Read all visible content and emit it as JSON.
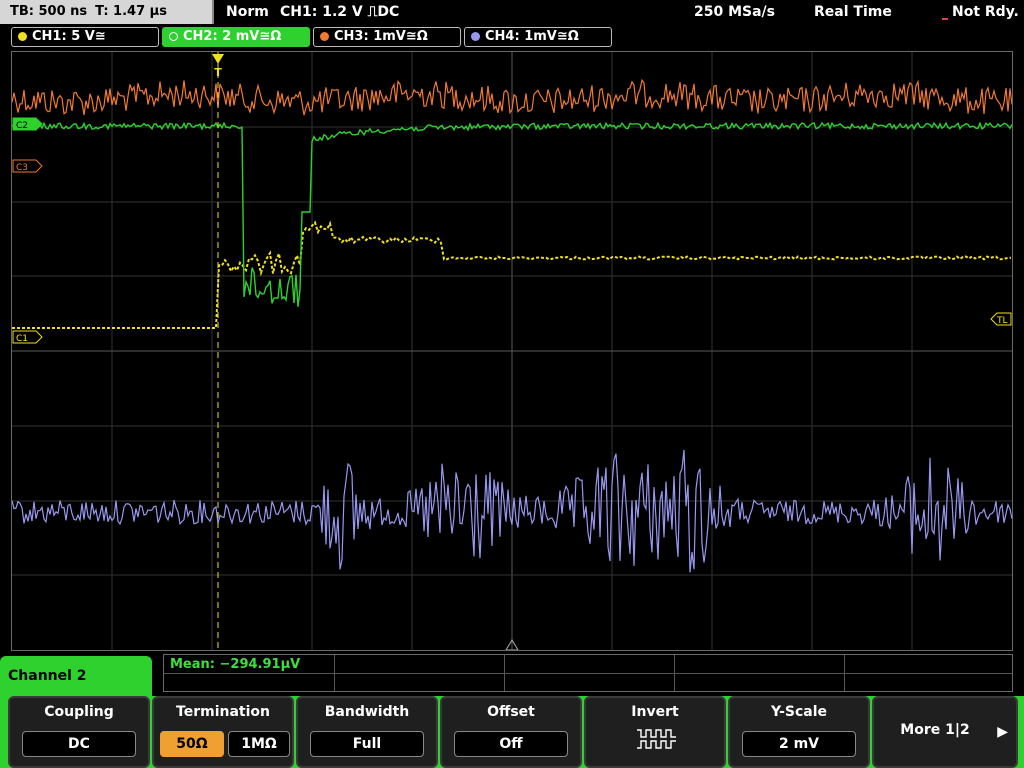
{
  "status": {
    "timebase": "TB: 500 ns",
    "trigger_time": "T: 1.47 µs",
    "mode": "Norm",
    "trigger_info": "CH1: 1.2 V ⎍DC",
    "sample_rate": "250 MSa/s",
    "acquire_mode": "Real Time",
    "ready_state": "Not Rdy."
  },
  "channels": [
    {
      "label": "CH1: 5 V≅",
      "color": "#f0e020"
    },
    {
      "label": "CH2: 2 mV≅Ω",
      "color": "#2ed12e"
    },
    {
      "label": "CH3: 1mV≅Ω",
      "color": "#f07a30"
    },
    {
      "label": "CH4: 1mV≅Ω",
      "color": "#9898f0"
    }
  ],
  "markers": {
    "c3": "C3",
    "c2": "C2",
    "c1": "C1",
    "tl": "TL",
    "trigger": "T"
  },
  "measurement": {
    "mean": "Mean: −294.91µV"
  },
  "panel_title": "Channel 2",
  "softkeys": {
    "coupling": {
      "title": "Coupling",
      "value": "DC"
    },
    "termination": {
      "title": "Termination",
      "opt1": "50Ω",
      "opt2": "1MΩ"
    },
    "bandwidth": {
      "title": "Bandwidth",
      "value": "Full"
    },
    "offset": {
      "title": "Offset",
      "value": "Off"
    },
    "invert": {
      "title": "Invert"
    },
    "yscale": {
      "title": "Y-Scale",
      "value": "2 mV"
    },
    "more": {
      "label": "More 1|2"
    }
  },
  "colors": {
    "grid": "#404040",
    "accent": "#2ed12e",
    "termination_selected": "#f0a030"
  }
}
